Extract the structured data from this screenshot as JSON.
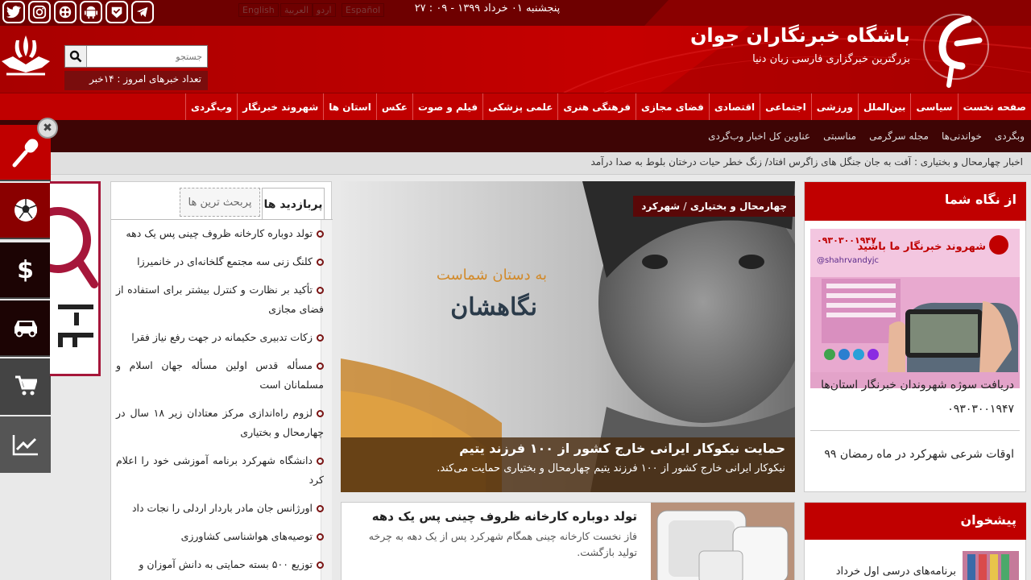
{
  "header": {
    "datetime": "۲۷ : ۰۹ - پنجشنبه ۰۱ خرداد ۱۳۹۹",
    "brand_title": "باشگاه خبرنگاران جوان",
    "brand_subtitle": "بزرگترین خبرگزاری فارسی زبان دنیا",
    "languages": [
      "English",
      "العربیة",
      "اردو",
      "Español"
    ],
    "search_placeholder": "جستجو",
    "news_count": "تعداد خبرهای امروز : ۱۴خبر",
    "social_icons": [
      "twitter-icon",
      "instagram-icon",
      "aparat-icon",
      "android-icon",
      "soroush-icon",
      "telegram-icon"
    ]
  },
  "nav": {
    "primary": [
      "صفحه نخست",
      "سیاسی",
      "بین‌الملل",
      "ورزشی",
      "اجتماعی",
      "اقتصادی",
      "فضای مجازی",
      "فرهنگی هنری",
      "علمی پزشکی",
      "فیلم و صوت",
      "عکس",
      "استان ها",
      "شهروند خبرنگار",
      "وب‌گردی"
    ],
    "secondary": [
      "وبگردی",
      "خواندنی‌ها",
      "مجله سرگرمی",
      "مناسبتی",
      "عناوین کل اخبار وب‌گردی"
    ]
  },
  "ticker": "اخبار چهارمحال و بختیاری : آفت به جان جنگل های زاگرس افتاد/ زنگ خطر حیات درختان بلوط به صدا درآمد",
  "sidebar": {
    "items": [
      "microphone-icon",
      "football-icon",
      "dollar-icon",
      "car-icon",
      "cart-icon",
      "chart-icon"
    ],
    "close": "✖"
  },
  "tabs": {
    "active": "پربازدید ها",
    "inactive": "پربحث ترین ها",
    "items": [
      "تولد دوباره کارخانه ظروف چینی پس یک دهه",
      "کلنگ زنی سه مجتمع گلخانه‌ای در خانمیرزا",
      "تأکید بر نظارت و کنترل بیشتر برای استفاده از فضای مجازی",
      "زکات تدبیری حکیمانه در جهت رفع نیاز فقرا",
      "مسأله قدس اولین مسأله جهان اسلام و مسلمانان است",
      "لزوم راه‌اندازی مرکز معتادان زیر ۱۸ سال در چهارمحال و بختیاری",
      "دانشگاه شهرکرد برنامه آموزشی خود را اعلام کرد",
      "اورژانس جان مادر باردار اردلی را نجات داد",
      "توصیه‌های هواشناسی کشاورزی",
      "توزیع ۵۰۰ بسته حمایتی به دانش آموزان و"
    ]
  },
  "hero": {
    "category": "چهارمحال و بختیاری",
    "subcategory": "شهرکرد",
    "separator": "/",
    "overlay_small": "به دستان شماست",
    "overlay_big": "نگاهشان",
    "title": "حمایت نیکوکار ایرانی خارج کشور از ۱۰۰ فرزند یتیم",
    "lead": "نیکوکار ایرانی خارج کشور از ۱۰۰ فرزند یتیم چهارمحال و بختیاری حمایت می‌کند."
  },
  "card": {
    "title": "تولد دوباره کارخانه ظروف چینی پس یک دهه",
    "lead": "فاز نخست کارخانه چینی همگام شهرکرد پس از یک دهه به چرخه تولید بازگشت."
  },
  "az_negah": {
    "heading": "از نگاه شما",
    "poster_title": "شهروند خبرنگار ما باشید",
    "poster_number": "۰۹۳۰۳۰۰۱۹۴۷",
    "poster_handle": "@shahrvandyjc",
    "item1": "دریافت سوژه شهروندان خبرنگار استان‌ها",
    "item1_number": "۰۹۳۰۳۰۰۱۹۴۷",
    "item2": "اوقات شرعی شهرکرد در ماه رمضان ۹۹"
  },
  "pishkhan": {
    "heading": "پیشخوان",
    "item": "برنامه‌های درسی اول خرداد"
  },
  "colors": {
    "brand_red": "#c00000",
    "dark_red": "#6e0000",
    "nav_dark": "#3e0505"
  }
}
